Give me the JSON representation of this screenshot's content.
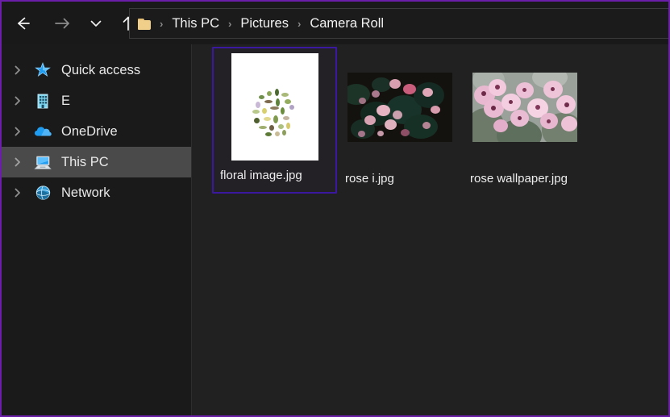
{
  "window": {
    "title": "File Explorer",
    "frame_accent_color": "#6b1fa8",
    "selection_color": "#3b18a0",
    "sidebar_bg": "#1a1a1a",
    "content_bg": "#212121"
  },
  "toolbar": {
    "back_label": "Back",
    "forward_label": "Forward",
    "recent_label": "Recent locations",
    "up_label": "Up to Pictures",
    "back_icon": "arrow-left-icon",
    "forward_icon": "arrow-right-icon",
    "recent_icon": "chevron-down-icon",
    "up_icon": "arrow-up-icon"
  },
  "address_bar": {
    "folder_icon": "folder-icon",
    "separator": "›",
    "crumbs": [
      {
        "label": "This PC"
      },
      {
        "label": "Pictures"
      },
      {
        "label": "Camera Roll"
      }
    ]
  },
  "sidebar": {
    "items": [
      {
        "label": "Quick access",
        "icon": "star-icon",
        "expander": "chevron-right-icon",
        "selected": false
      },
      {
        "label": "E",
        "icon": "building-icon",
        "expander": "chevron-right-icon",
        "selected": false
      },
      {
        "label": "OneDrive",
        "icon": "cloud-icon",
        "expander": "chevron-right-icon",
        "selected": false
      },
      {
        "label": "This PC",
        "icon": "computer-icon",
        "expander": "chevron-right-icon",
        "selected": true
      },
      {
        "label": "Network",
        "icon": "network-icon",
        "expander": "chevron-right-icon",
        "selected": false
      }
    ]
  },
  "files": [
    {
      "name": "floral image.jpg",
      "kind": "image",
      "thumb": "white-card-floral-posy",
      "selected": true
    },
    {
      "name": "rose i.jpg",
      "kind": "image",
      "thumb": "dark-pink-roses-photo",
      "selected": false
    },
    {
      "name": "rose wallpaper.jpg",
      "kind": "image",
      "thumb": "pink-blossom-photo",
      "selected": false
    }
  ]
}
